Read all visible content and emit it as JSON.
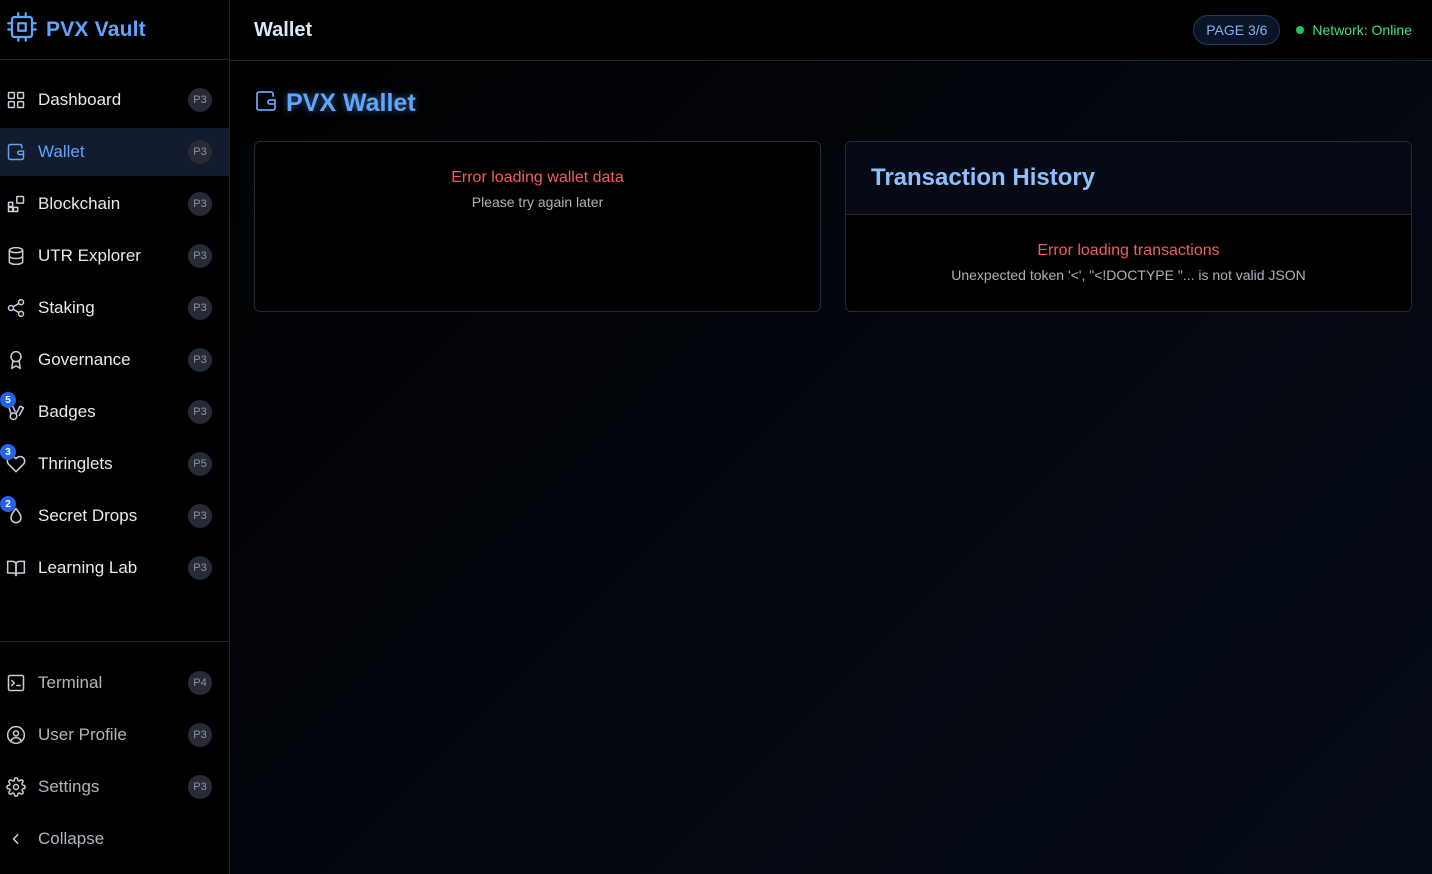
{
  "brand": {
    "title": "PVX Vault",
    "accent": "#60a5fa"
  },
  "nav": {
    "items": [
      {
        "label": "Dashboard",
        "tag": "P3",
        "icon": "grid-icon"
      },
      {
        "label": "Wallet",
        "tag": "P3",
        "icon": "wallet-icon",
        "active": true
      },
      {
        "label": "Blockchain",
        "tag": "P3",
        "icon": "blocks-icon"
      },
      {
        "label": "UTR Explorer",
        "tag": "P3",
        "icon": "database-icon"
      },
      {
        "label": "Staking",
        "tag": "P3",
        "icon": "share-icon"
      },
      {
        "label": "Governance",
        "tag": "P3",
        "icon": "award-icon"
      },
      {
        "label": "Badges",
        "tag": "P3",
        "icon": "badge-icon",
        "count": "5"
      },
      {
        "label": "Thringlets",
        "tag": "P5",
        "icon": "heart-icon",
        "count": "3"
      },
      {
        "label": "Secret Drops",
        "tag": "P3",
        "icon": "drop-icon",
        "count": "2"
      },
      {
        "label": "Learning Lab",
        "tag": "P3",
        "icon": "book-icon"
      }
    ],
    "bottom": [
      {
        "label": "Terminal",
        "tag": "P4",
        "icon": "terminal-icon"
      },
      {
        "label": "User Profile",
        "tag": "P3",
        "icon": "user-circle-icon"
      },
      {
        "label": "Settings",
        "tag": "P3",
        "icon": "gear-icon"
      }
    ],
    "collapse_label": "Collapse"
  },
  "topbar": {
    "title": "Wallet",
    "page_badge": "PAGE 3/6",
    "status": "Network: Online",
    "status_color": "#22c55e"
  },
  "main": {
    "heading": "PVX Wallet",
    "wallet_card": {
      "error_title": "Error loading wallet data",
      "error_sub": "Please try again later"
    },
    "tx_card": {
      "title": "Transaction History",
      "error_title": "Error loading transactions",
      "error_sub": "Unexpected token '<', \"<!DOCTYPE \"... is not valid JSON"
    },
    "error_color": "#f25c5c"
  }
}
